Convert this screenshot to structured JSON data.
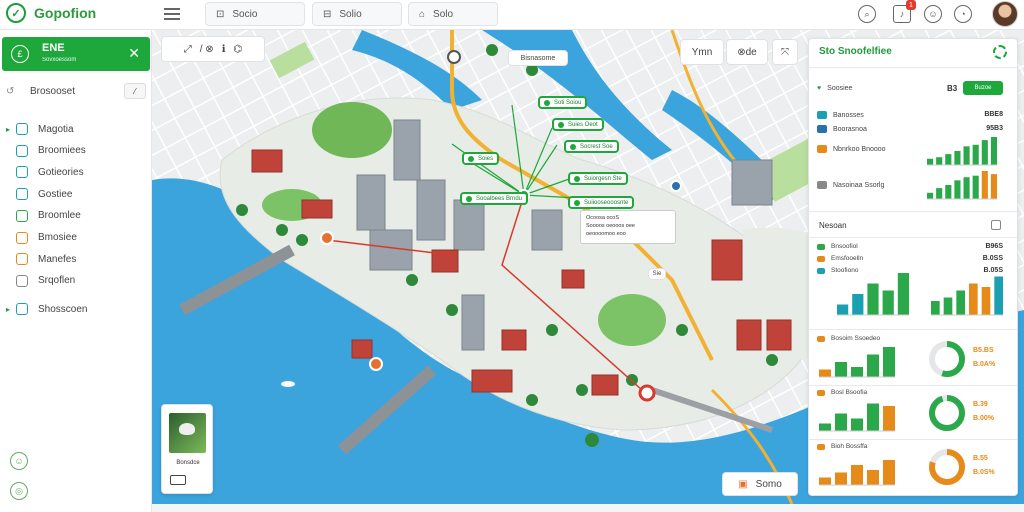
{
  "app": {
    "name": "Gopofion"
  },
  "topbar": {
    "tabs": [
      {
        "label": "Socio"
      },
      {
        "label": "Solio"
      },
      {
        "label": "Solo"
      }
    ],
    "notification_count": "1"
  },
  "sidebar": {
    "header": {
      "title": "ENE",
      "subtitle": "Sovxoessom"
    },
    "search_label": "Brosooset",
    "items": [
      {
        "label": "Magotia",
        "color": "#1aa0b0"
      },
      {
        "label": "Broomiees",
        "color": "#1aa0b0"
      },
      {
        "label": "Gotieories",
        "color": "#1aa0b0"
      },
      {
        "label": "Gostiee",
        "color": "#1aa0b0"
      },
      {
        "label": "Broomlee",
        "color": "#2aa84a"
      },
      {
        "label": "Bmosiee",
        "color": "#e68a1a"
      },
      {
        "label": "Manefes",
        "color": "#e68a1a"
      },
      {
        "label": "Srqoflen",
        "color": "#888888"
      },
      {
        "label": "Shosscoen",
        "color": "#1aa0b0"
      }
    ]
  },
  "map": {
    "toolbar": {
      "left_label": "/ ⊗",
      "btn1": "Ymn",
      "btn2": "⊗de"
    },
    "callout_top": "Bisnasome",
    "callouts": [
      {
        "label": "Soti Soiou"
      },
      {
        "label": "Suies Oeot"
      },
      {
        "label": "Socrest Soe"
      },
      {
        "label": "Soies"
      },
      {
        "label": "Suiorgesn Ste"
      },
      {
        "label": "Suiiooseooosnte"
      },
      {
        "label": "Sooalbees Brndu"
      }
    ],
    "info_card": {
      "line1": "Ocoosa ocoS",
      "line2": "Soooos oeooos oee",
      "line3": "oeoooomoo eoo"
    },
    "small_tag": "Sie",
    "bottom_button": "Somo"
  },
  "thumb": {
    "label": "Bonsdce"
  },
  "panel": {
    "title": "Sto Snoofelfiee",
    "session": {
      "label": "Soosiee",
      "count": "B3",
      "action": "Buzoe"
    },
    "kpis": [
      {
        "label": "Banosses",
        "value": "BBE8",
        "color": "#1aa0b0"
      },
      {
        "label": "Boorasnoa",
        "value": "95B3",
        "color": "#2a6fb0"
      },
      {
        "label": "Nbnrkoo Bnoooo",
        "color": "#e68a1a"
      },
      {
        "label": "Nasoinaa Ssorlg",
        "color": "#888888"
      }
    ],
    "section": {
      "title": "Nesoan"
    },
    "legend": [
      {
        "label": "Bnsoofiol",
        "value": "B96S",
        "color": "#2aa84a"
      },
      {
        "label": "Emsfooelln",
        "value": "B.0SS",
        "color": "#e68a1a"
      },
      {
        "label": "Stoofiono",
        "value": "B.05S",
        "color": "#1aa0b0"
      }
    ],
    "stats": [
      {
        "label": "Bosoim Ssoedeo",
        "v1": "B5.BS",
        "v2": "B.0A%",
        "ring_color": "#2aa84a",
        "ring_fill": 0.55
      },
      {
        "label": "Bosl Bsoofia",
        "v1": "B.39",
        "v2": "B.00%",
        "ring_color": "#2aa84a",
        "ring_fill": 0.95
      },
      {
        "label": "Bioh Bossffa",
        "v1": "B.55",
        "v2": "B.0S%",
        "ring_color": "#e68a1a",
        "ring_fill": 0.8
      }
    ],
    "charts": {
      "top_bars": [
        {
          "values": [
            4,
            5,
            7,
            9,
            12,
            13,
            16,
            18
          ],
          "color": "#2aa84a"
        },
        {
          "values": [
            4,
            7,
            9,
            12,
            14,
            15,
            18,
            16
          ],
          "color": "#2aa84a"
        }
      ],
      "mid_group_a": [
        {
          "v": 3,
          "c": "#1aa0b0"
        },
        {
          "v": 6,
          "c": "#1aa0b0"
        },
        {
          "v": 9,
          "c": "#2aa84a"
        },
        {
          "v": 7,
          "c": "#2aa84a"
        },
        {
          "v": 12,
          "c": "#2aa84a"
        }
      ],
      "mid_group_b": [
        {
          "v": 4,
          "c": "#2aa84a"
        },
        {
          "v": 5,
          "c": "#2aa84a"
        },
        {
          "v": 7,
          "c": "#2aa84a"
        },
        {
          "v": 9,
          "c": "#e68a1a"
        },
        {
          "v": 8,
          "c": "#e68a1a"
        },
        {
          "v": 11,
          "c": "#1aa0b0"
        }
      ],
      "row_bars": [
        [
          {
            "v": 3,
            "c": "#e68a1a"
          },
          {
            "v": 6,
            "c": "#2aa84a"
          },
          {
            "v": 4,
            "c": "#2aa84a"
          },
          {
            "v": 9,
            "c": "#2aa84a"
          },
          {
            "v": 12,
            "c": "#2aa84a"
          }
        ],
        [
          {
            "v": 3,
            "c": "#2aa84a"
          },
          {
            "v": 7,
            "c": "#2aa84a"
          },
          {
            "v": 5,
            "c": "#2aa84a"
          },
          {
            "v": 11,
            "c": "#2aa84a"
          },
          {
            "v": 10,
            "c": "#e68a1a"
          }
        ],
        [
          {
            "v": 3,
            "c": "#e68a1a"
          },
          {
            "v": 5,
            "c": "#e68a1a"
          },
          {
            "v": 8,
            "c": "#e68a1a"
          },
          {
            "v": 6,
            "c": "#e68a1a"
          },
          {
            "v": 10,
            "c": "#e68a1a"
          }
        ]
      ]
    }
  }
}
